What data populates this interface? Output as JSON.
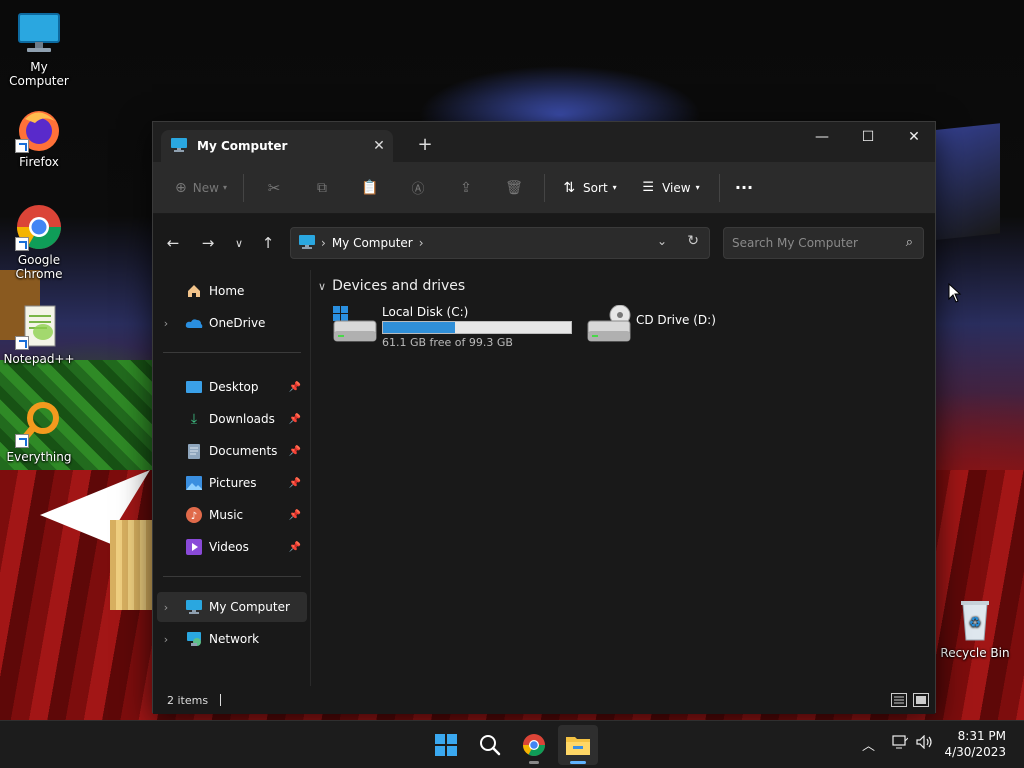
{
  "desktop": {
    "icons": [
      {
        "label": "My Computer",
        "icon": "monitor-icon"
      },
      {
        "label": "Firefox",
        "icon": "firefox-icon"
      },
      {
        "label": "Google Chrome",
        "icon": "chrome-icon"
      },
      {
        "label": "Notepad++",
        "icon": "notepadpp-icon"
      },
      {
        "label": "Everything",
        "icon": "search-magnifier-icon"
      },
      {
        "label": "Recycle Bin",
        "icon": "recycle-bin-icon"
      }
    ]
  },
  "window": {
    "tab_title": "My Computer",
    "tab_close": "✕",
    "new_tab": "+",
    "controls": {
      "minimize": "—",
      "maximize": "☐",
      "close": "✕"
    }
  },
  "toolbar": {
    "new_label": "New",
    "sort_label": "Sort",
    "view_label": "View",
    "more_label": "···"
  },
  "address": {
    "crumb": "My Computer",
    "search_placeholder": "Search My Computer"
  },
  "sidebar": {
    "items": [
      {
        "label": "Home",
        "pinned": false
      },
      {
        "label": "OneDrive",
        "pinned": false
      },
      {
        "label": "Desktop",
        "pinned": true
      },
      {
        "label": "Downloads",
        "pinned": true
      },
      {
        "label": "Documents",
        "pinned": true
      },
      {
        "label": "Pictures",
        "pinned": true
      },
      {
        "label": "Music",
        "pinned": true
      },
      {
        "label": "Videos",
        "pinned": true
      },
      {
        "label": "My Computer",
        "pinned": false,
        "selected": true
      },
      {
        "label": "Network",
        "pinned": false
      }
    ]
  },
  "content": {
    "group_header": "Devices and drives",
    "drives": [
      {
        "name": "Local Disk (C:)",
        "free": "61.1 GB free of 99.3 GB",
        "used_fraction": 0.385
      },
      {
        "name": "CD Drive (D:)"
      }
    ]
  },
  "status": {
    "items": "2 items"
  },
  "taskbar": {
    "time": "8:31 PM",
    "date": "4/30/2023"
  },
  "colors": {
    "accent": "#2f8fd8",
    "window_bg": "#191919",
    "toolbar_bg": "#2b2b2b"
  }
}
